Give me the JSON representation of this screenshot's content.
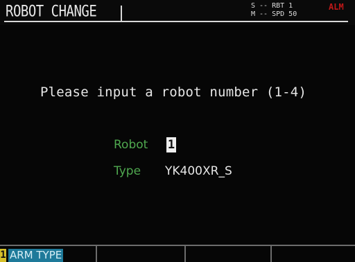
{
  "header": {
    "title": "ROBOT CHANGE",
    "status_line1": "S -- RBT 1",
    "status_line2": "M -- SPD 50",
    "alarm": "ALM"
  },
  "main": {
    "prompt": "Please input a robot number (1-4)",
    "robot_label": "Robot",
    "robot_value": "1",
    "type_label": "Type",
    "type_value": "YK400XR_S"
  },
  "function_keys": [
    {
      "number": "1",
      "label": "ARM TYPE"
    },
    {
      "number": "",
      "label": ""
    },
    {
      "number": "",
      "label": ""
    },
    {
      "number": "",
      "label": ""
    }
  ],
  "colors": {
    "background": "#060606",
    "text": "#e6e6e6",
    "label_green": "#4fa84f",
    "alarm_red": "#c01818",
    "fkey_blue": "#1e7a9a",
    "fkey_yellow": "#d6c02a"
  }
}
